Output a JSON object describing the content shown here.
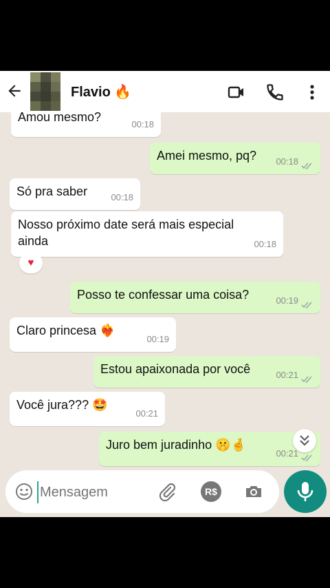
{
  "header": {
    "contact_name": "Flavio 🔥",
    "icons": [
      "back-arrow-icon",
      "video-call-icon",
      "phone-icon",
      "more-options-icon"
    ]
  },
  "messages": [
    {
      "dir": "in",
      "text": "Amou mesmo?",
      "time": "00:18"
    },
    {
      "dir": "out",
      "text": "Amei mesmo, pq?",
      "time": "00:18"
    },
    {
      "dir": "in",
      "text": "Só pra saber",
      "time": "00:18"
    },
    {
      "dir": "in",
      "text": "Nosso próximo date será mais especial ainda",
      "time": "00:18",
      "reaction": "♥"
    },
    {
      "dir": "out",
      "text": "Posso te confessar uma coisa?",
      "time": "00:19"
    },
    {
      "dir": "in",
      "text": "Claro princesa",
      "emoji": "❤️‍🔥",
      "time": "00:19"
    },
    {
      "dir": "out",
      "text": "Estou apaixonada por você",
      "time": "00:21"
    },
    {
      "dir": "in",
      "text": "Você jura???",
      "emoji": "🤩",
      "time": "00:21"
    },
    {
      "dir": "out",
      "text": "Juro bem juradinho",
      "emoji": "🤫🤞",
      "time": "00:21"
    }
  ],
  "input": {
    "placeholder": "Mensagem",
    "icons": [
      "emoji-icon",
      "attach-icon",
      "payment-icon",
      "camera-icon",
      "mic-icon"
    ],
    "payment_label": "R$"
  },
  "colors": {
    "outgoing_bubble": "#dcf8c6",
    "incoming_bubble": "#ffffff",
    "chat_background": "#ece5dd",
    "accent": "#128c7e"
  }
}
